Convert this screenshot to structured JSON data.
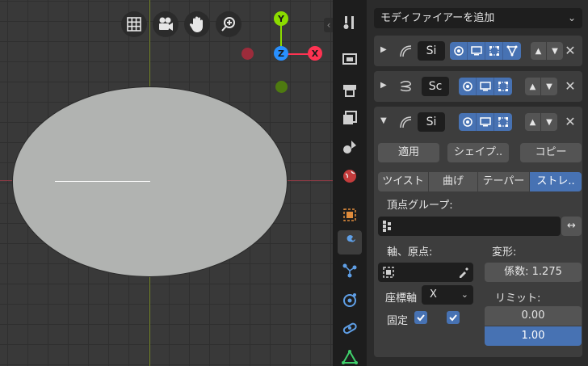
{
  "viewport": {
    "gizmo": {
      "y_label": "Y",
      "z_label": "Z",
      "x_label": "X"
    },
    "icons": [
      "grid-icon",
      "camera-icon",
      "hand-icon",
      "zoom-icon"
    ]
  },
  "properties": {
    "add_modifier": "モディファイアーを追加",
    "modifiers": [
      {
        "name": "Si",
        "expanded": false
      },
      {
        "name": "Sc",
        "expanded": false
      },
      {
        "name": "Si",
        "expanded": true
      }
    ],
    "actions": {
      "apply": "適用",
      "shape": "シェイプ..",
      "copy": "コピー"
    },
    "mode_tabs": [
      "ツイスト",
      "曲げ",
      "テーパー",
      "ストレ.."
    ],
    "active_mode": 3,
    "vertex_group_label": "頂点グループ:",
    "axis_origin_label": "軸、原点:",
    "deform_label": "変形:",
    "factor_label": "係数:",
    "factor_value": "1.275",
    "coord_axis_label": "座標軸",
    "coord_axis_value": "X",
    "limit_label": "リミット:",
    "limit_min": "0.00",
    "limit_max": "1.00",
    "lock_label": "固定"
  },
  "colors": {
    "accent": "#4772b3",
    "x_axis": "#ff3352",
    "y_axis": "#8bdc00",
    "z_axis": "#2890ff"
  }
}
